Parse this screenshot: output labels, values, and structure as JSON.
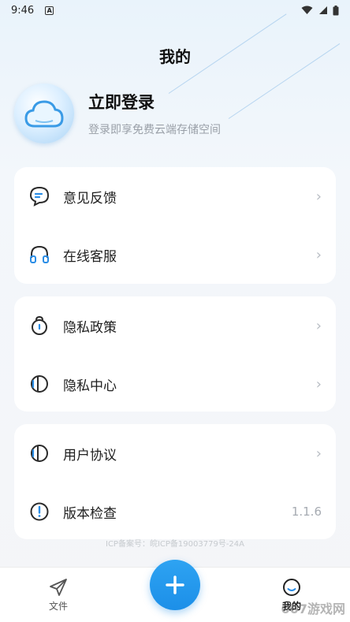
{
  "status_bar": {
    "time": "9:46",
    "notif_glyph": "A"
  },
  "header": {
    "title": "我的"
  },
  "profile": {
    "title": "立即登录",
    "subtitle": "登录即享免费云端存储空间"
  },
  "menu_groups": [
    [
      {
        "label": "意见反馈",
        "icon": "feedback-icon"
      },
      {
        "label": "在线客服",
        "icon": "headset-icon"
      }
    ],
    [
      {
        "label": "隐私政策",
        "icon": "lock-icon"
      },
      {
        "label": "隐私中心",
        "icon": "privacy-shield-icon"
      }
    ],
    [
      {
        "label": "用户协议",
        "icon": "agreement-icon"
      },
      {
        "label": "版本检查",
        "icon": "info-icon",
        "value": "1.1.6"
      }
    ]
  ],
  "icp_text": "ICP备案号：皖ICP备19003779号-24A",
  "tabbar": {
    "files_label": "文件",
    "mine_label": "我的",
    "add_icon": "plus-icon"
  },
  "watermark": "007游戏网",
  "colors": {
    "accent": "#1f93ea",
    "icon_dark": "#2a2a2a",
    "icon_blue": "#2a8de6"
  }
}
